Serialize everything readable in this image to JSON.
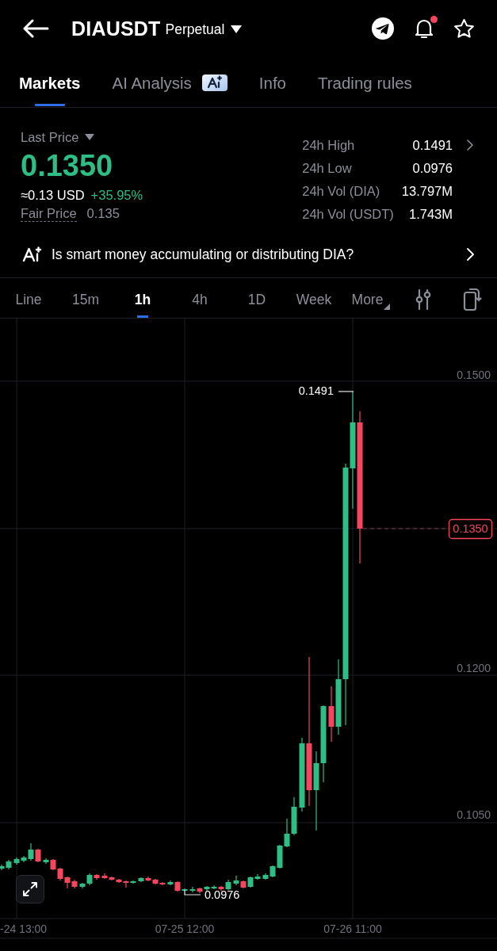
{
  "header": {
    "symbol": "DIAUSDT",
    "contract_type": "Perpetual",
    "alert_unread": true
  },
  "tabs": [
    {
      "label": "Markets",
      "selected": true,
      "ai_badge": false
    },
    {
      "label": "AI Analysis",
      "selected": false,
      "ai_badge": true
    },
    {
      "label": "Info",
      "selected": false,
      "ai_badge": false
    },
    {
      "label": "Trading rules",
      "selected": false,
      "ai_badge": false
    }
  ],
  "price": {
    "label": "Last Price",
    "value": "0.1350",
    "usd_equivalent": "≈0.13 USD",
    "change": "+35.95%",
    "fair_price_label": "Fair Price",
    "fair_price": "0.135"
  },
  "stats": [
    {
      "label": "24h High",
      "value": "0.1491",
      "chevron": true
    },
    {
      "label": "24h Low",
      "value": "0.0976",
      "chevron": false
    },
    {
      "label": "24h Vol (DIA)",
      "value": "13.797M",
      "chevron": false
    },
    {
      "label": "24h Vol (USDT)",
      "value": "1.743M",
      "chevron": false
    }
  ],
  "ai_prompt": {
    "text": "Is smart money accumulating or distributing DIA?"
  },
  "intervals": [
    {
      "label": "Line",
      "selected": false,
      "kind": "option"
    },
    {
      "label": "15m",
      "selected": false,
      "kind": "option"
    },
    {
      "label": "1h",
      "selected": true,
      "kind": "option"
    },
    {
      "label": "4h",
      "selected": false,
      "kind": "option"
    },
    {
      "label": "1D",
      "selected": false,
      "kind": "option"
    },
    {
      "label": "Week",
      "selected": false,
      "kind": "option"
    },
    {
      "label": "More",
      "selected": false,
      "kind": "menu"
    }
  ],
  "chart": {
    "y_axis_labels": [
      "0.1500",
      "0.1200",
      "0.1050"
    ],
    "x_axis_labels": [
      "-24 13:00",
      "07-25 12:00",
      "07-26 11:00"
    ],
    "high_label": "0.1491",
    "low_label": "0.0976",
    "last_price_tag": "0.1350"
  }
}
